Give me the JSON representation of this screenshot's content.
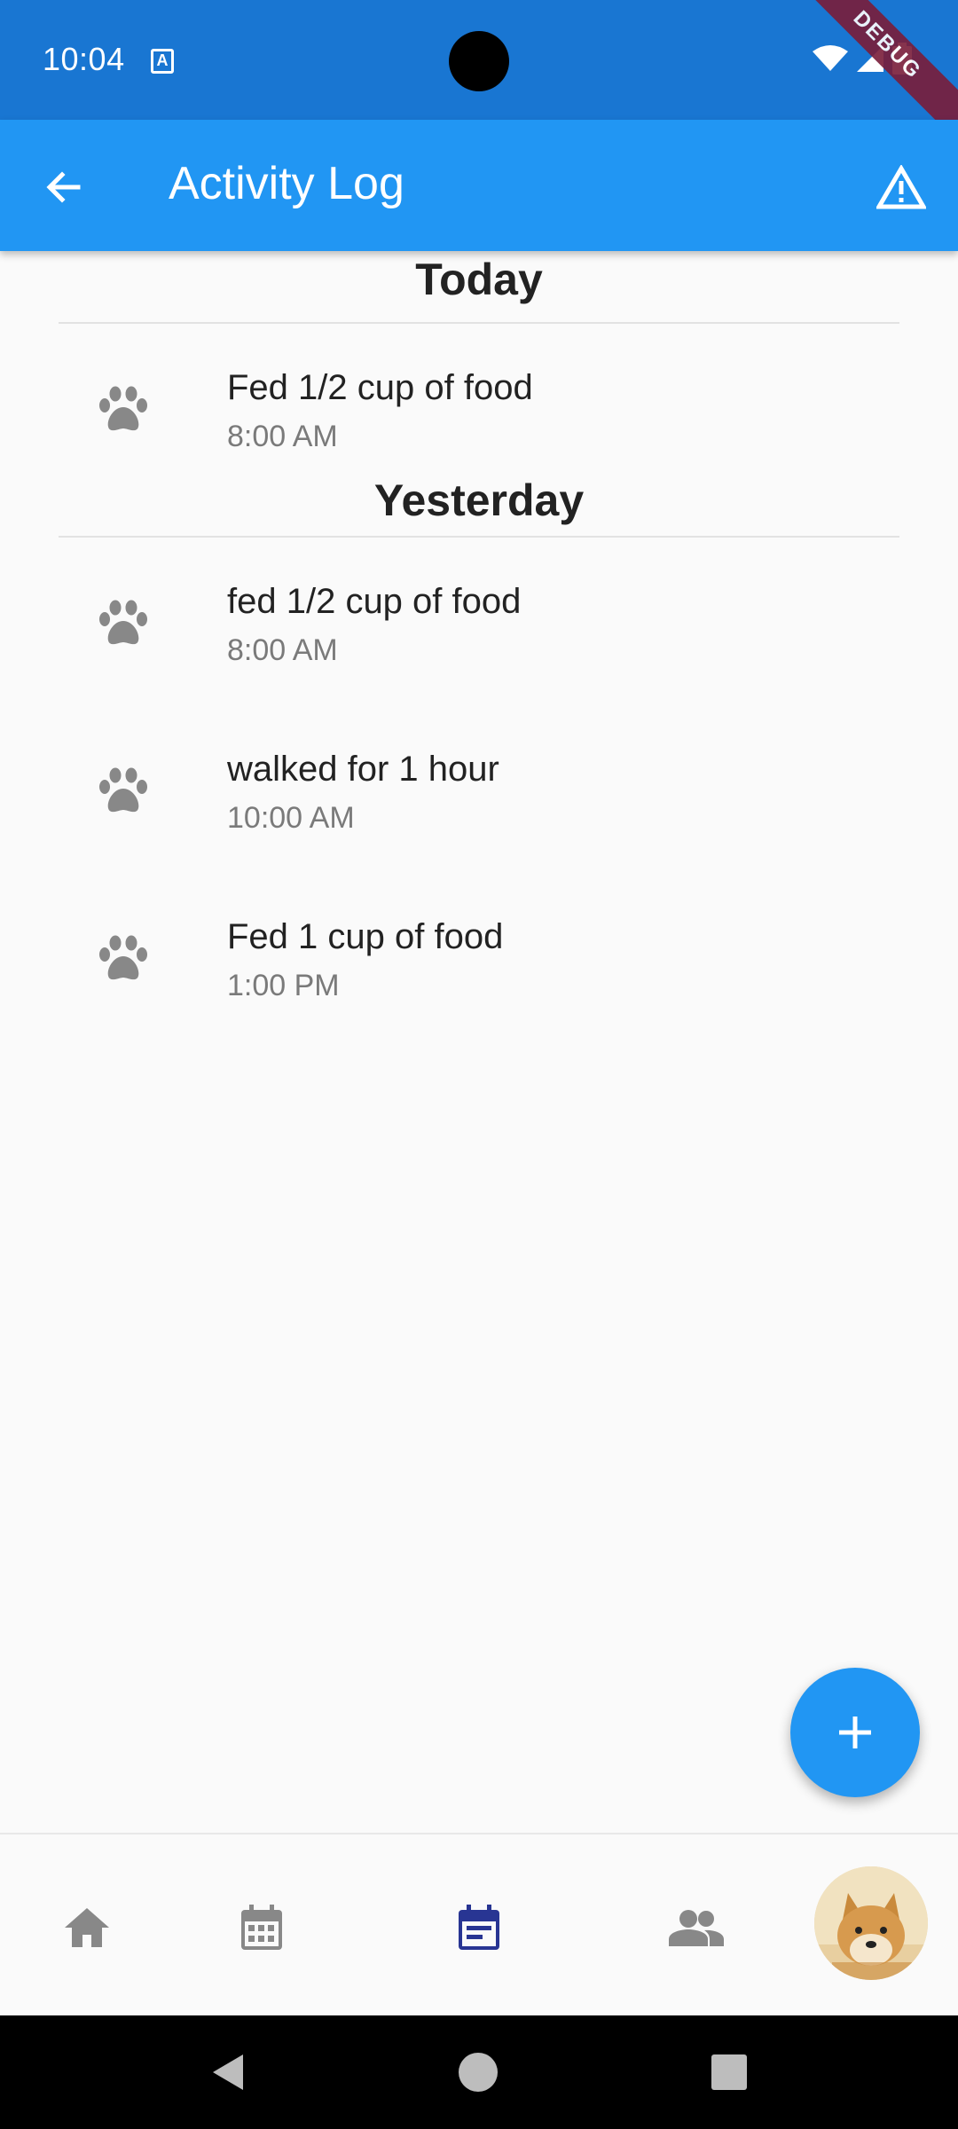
{
  "status_bar": {
    "time": "10:04",
    "debug_banner": "DEBUG"
  },
  "app_bar": {
    "title": "Activity Log",
    "back_icon": "arrow-back-icon",
    "action_icon": "warning-icon"
  },
  "sections": [
    {
      "header": "Today",
      "items": [
        {
          "icon": "paw-icon",
          "title": "Fed 1/2 cup of food",
          "time": "8:00 AM"
        }
      ]
    },
    {
      "header": "Yesterday",
      "items": [
        {
          "icon": "paw-icon",
          "title": "fed 1/2 cup of food",
          "time": "8:00 AM"
        },
        {
          "icon": "paw-icon",
          "title": "walked for 1 hour",
          "time": "10:00 AM"
        },
        {
          "icon": "paw-icon",
          "title": "Fed 1 cup of food",
          "time": "1:00 PM"
        }
      ]
    }
  ],
  "fab": {
    "icon": "plus-icon"
  },
  "bottom_nav": {
    "items": [
      {
        "icon": "home-icon",
        "active": false
      },
      {
        "icon": "calendar-icon",
        "active": false
      },
      {
        "icon": "event-note-icon",
        "active": true
      },
      {
        "icon": "people-icon",
        "active": false
      },
      {
        "icon": "avatar",
        "active": false
      }
    ]
  },
  "colors": {
    "primary": "#2196f3",
    "status_bar": "#1976d2",
    "active_nav": "#283593",
    "inactive_icon": "#888888"
  }
}
